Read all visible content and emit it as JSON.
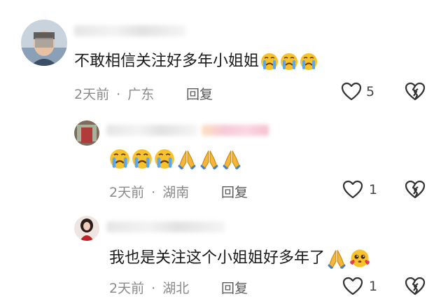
{
  "comments": [
    {
      "text": "不敢相信关注好多年小姐姐",
      "emojis": [
        "crying-face",
        "crying-face",
        "crying-face"
      ],
      "time": "2天前",
      "separator": "·",
      "location": "广东",
      "reply_label": "回复",
      "like_count": "5"
    },
    {
      "text": "",
      "emojis": [
        "crying-face",
        "crying-face",
        "crying-face",
        "folded-hands",
        "folded-hands",
        "folded-hands"
      ],
      "time": "2天前",
      "separator": "·",
      "location": "湖南",
      "reply_label": "回复",
      "like_count": "1"
    },
    {
      "text": "我也是关注这个小姐姐好多年了",
      "emojis": [
        "folded-hands",
        "pleading-hearts-face"
      ],
      "time": "2天前",
      "separator": "·",
      "location": "湖北",
      "reply_label": "回复",
      "like_count": "1"
    }
  ],
  "colors": {
    "emoji_yellow": "#f7c22a",
    "emoji_blue": "#5aa7f0",
    "heart_red": "#e8384f",
    "meta_gray": "#8a8a8a"
  }
}
